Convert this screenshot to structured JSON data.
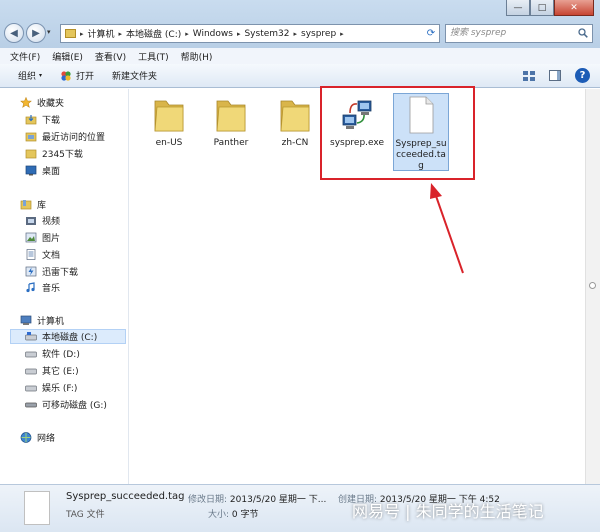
{
  "window": {
    "min": "—",
    "max": "□",
    "close": "✕"
  },
  "nav": {
    "back": "◀",
    "forward": "▶",
    "recent": "▾",
    "refresh": "⟳"
  },
  "address": {
    "crumbs": [
      "计算机",
      "本地磁盘 (C:)",
      "Windows",
      "System32",
      "sysprep"
    ],
    "sep": "▸",
    "drop": "▾"
  },
  "search": {
    "placeholder": "搜索 sysprep"
  },
  "menu": [
    "文件(F)",
    "编辑(E)",
    "查看(V)",
    "工具(T)",
    "帮助(H)"
  ],
  "toolbar": {
    "organize": "组织",
    "open": "打开",
    "new_folder": "新建文件夹",
    "caret": "▾",
    "help": "?"
  },
  "sidebar": {
    "favorites": {
      "label": "收藏夹",
      "items": [
        "下载",
        "最近访问的位置",
        "2345下载",
        "桌面"
      ]
    },
    "libraries": {
      "label": "库",
      "items": [
        "视频",
        "图片",
        "文档",
        "迅雷下载",
        "音乐"
      ]
    },
    "computer": {
      "label": "计算机",
      "items": [
        "本地磁盘 (C:)",
        "软件 (D:)",
        "其它 (E:)",
        "娱乐 (F:)",
        "可移动磁盘 (G:)"
      ]
    },
    "network": {
      "label": "网络"
    }
  },
  "files": [
    {
      "name": "en-US",
      "type": "folder"
    },
    {
      "name": "Panther",
      "type": "folder"
    },
    {
      "name": "zh-CN",
      "type": "folder"
    },
    {
      "name": "sysprep.exe",
      "type": "exe"
    },
    {
      "name": "Sysprep_succeeded.tag",
      "type": "file",
      "selected": true
    }
  ],
  "status": {
    "name": "Sysprep_succeeded.tag",
    "type": "TAG 文件",
    "modified_label": "修改日期:",
    "modified": "2013/5/20 星期一 下...",
    "created_label": "创建日期:",
    "created": "2013/5/20 星期一 下午 4:52",
    "size_label": "大小:",
    "size": "0 字节"
  },
  "watermark": "网易号 | 朱同学的生活笔记",
  "colors": {
    "highlight": "#d9232a",
    "selection": "#cce1f8",
    "folder": "#e4c65c"
  }
}
